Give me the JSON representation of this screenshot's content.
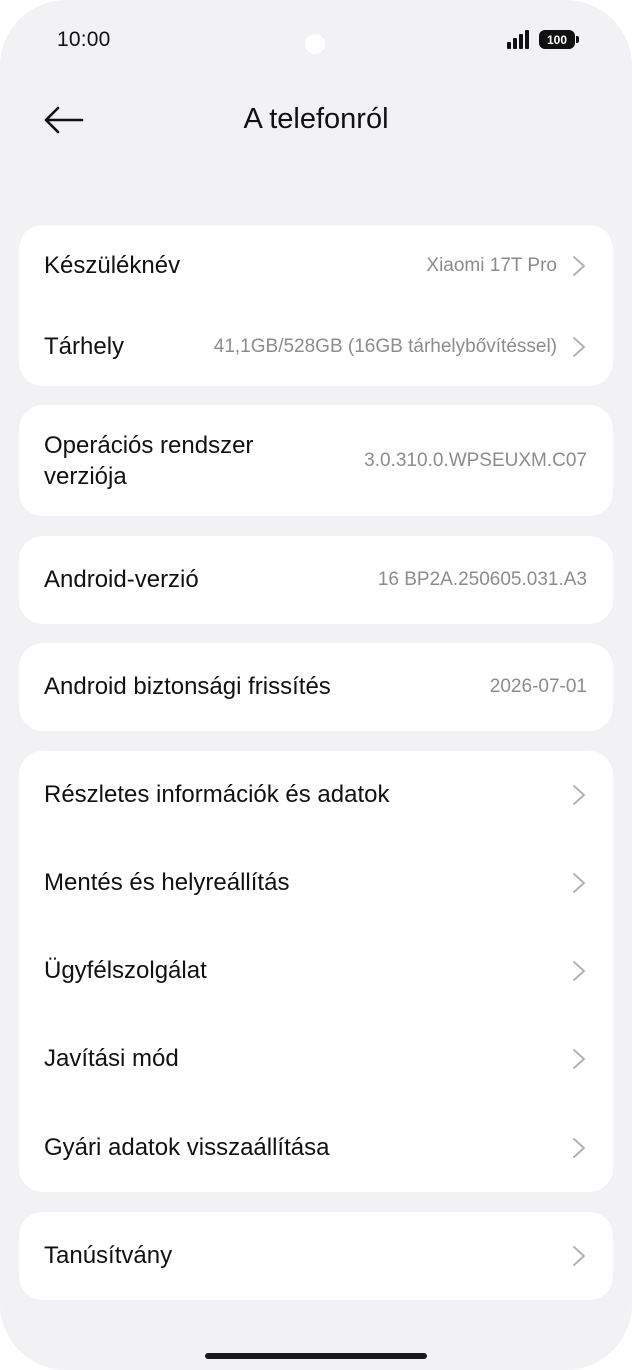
{
  "status_bar": {
    "time": "10:00",
    "battery": "100"
  },
  "header": {
    "title": "A telefonról",
    "back_icon": "arrow-left-icon"
  },
  "group1": {
    "device_name_label": "Készüléknév",
    "device_name_value": "Xiaomi 17T Pro",
    "storage_label": "Tárhely",
    "storage_value": "41,1GB/528GB (16GB tárhelybővítéssel)"
  },
  "os_version": {
    "label": "Operációs rendszer verziója",
    "value": "3.0.310.0.WPSEUXM.C07"
  },
  "android_version": {
    "label": "Android-verzió",
    "value": "16 BP2A.250605.031.A3"
  },
  "security_update": {
    "label": "Android biztonsági frissítés",
    "value": "2026-07-01"
  },
  "menu": {
    "items": [
      {
        "label": "Részletes információk és adatok"
      },
      {
        "label": "Mentés és helyreállítás"
      },
      {
        "label": "Ügyfélszolgálat"
      },
      {
        "label": "Javítási mód"
      },
      {
        "label": "Gyári adatok visszaállítása"
      }
    ]
  },
  "certification": {
    "label": "Tanúsítvány"
  },
  "colors": {
    "background": "#f2f2f4",
    "card": "#ffffff",
    "secondary_text": "#8c8c8c",
    "chevron": "#b3b3b3"
  }
}
